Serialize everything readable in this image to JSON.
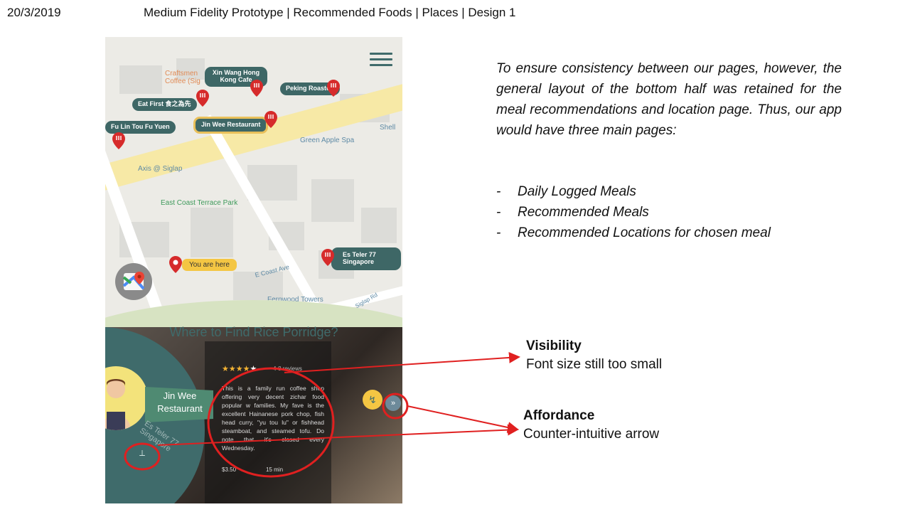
{
  "slide": {
    "date": "20/3/2019",
    "title": "Medium Fidelity Prototype | Recommended Foods | Places | Design 1"
  },
  "map": {
    "places": [
      {
        "name": "Craftsmen Coffee (Sig"
      },
      {
        "name": "Xin Wang Hong Kong Cafe"
      },
      {
        "name": "Peking Roasted"
      },
      {
        "name": "Eat First 食之為先"
      },
      {
        "name": "Jin Wee Restaurant"
      },
      {
        "name": "Fu Lin Tou Fu Yuen"
      },
      {
        "name": "Es Teler 77 Singapore"
      }
    ],
    "labels": {
      "shell": "Shell",
      "green_apple_spa": "Green Apple Spa",
      "axis": "Axis @ Siglap",
      "park": "East Coast Terrace Park",
      "ecoast_ave": "E Coast Ave",
      "fernwood": "Fernwood Towers",
      "siglap_rd": "Siglap Rd"
    },
    "you_are_here": "You are here"
  },
  "detail": {
    "heading": "Where to Find Rice Porridge?",
    "restaurant": "Jin Wee Restaurant",
    "side_address": "Es Teler 77 Singapore",
    "rating_stars": 4,
    "rating_max": 5,
    "reviews": "4-8 reviews",
    "description": "This is a family run coffee shop offering very decent zichar food popular w families. My fave is the excellent Hainanese pork chop, fish head curry, \"yu tou lu\" or fishhead steamboat, and steamed tofu. Do note that it's closed every Wednesday.",
    "price": "$3.50",
    "time": "15 min"
  },
  "notes": {
    "paragraph": "To ensure consistency between our pages, however, the general layout of the bottom half was retained for the meal recommendations and location page. Thus, our app would have three main pages:",
    "bullets": [
      "Daily Logged Meals",
      "Recommended Meals",
      "Recommended Locations for chosen meal"
    ]
  },
  "annotations": {
    "visibility": {
      "title": "Visibility",
      "body": "Font size still too small"
    },
    "affordance": {
      "title": "Affordance",
      "body": "Counter-intuitive arrow"
    }
  },
  "colors": {
    "teal": "#3f6b6b",
    "pin_red": "#d62b2b",
    "annotation_red": "#e02020",
    "yellow": "#f4c643"
  }
}
